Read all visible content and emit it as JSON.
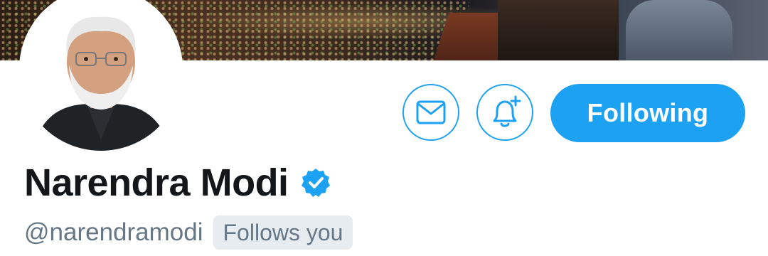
{
  "profile": {
    "name": "Narendra Modi",
    "handle": "@narendramodi",
    "follows_you": "Follows you",
    "verified": true
  },
  "actions": {
    "message_icon": "envelope-icon",
    "notify_icon": "bell-plus-icon",
    "follow_label": "Following"
  },
  "colors": {
    "accent": "#1da1f2",
    "name_text": "#14171a",
    "muted_text": "#657786",
    "badge_bg": "#e6ecf0"
  }
}
